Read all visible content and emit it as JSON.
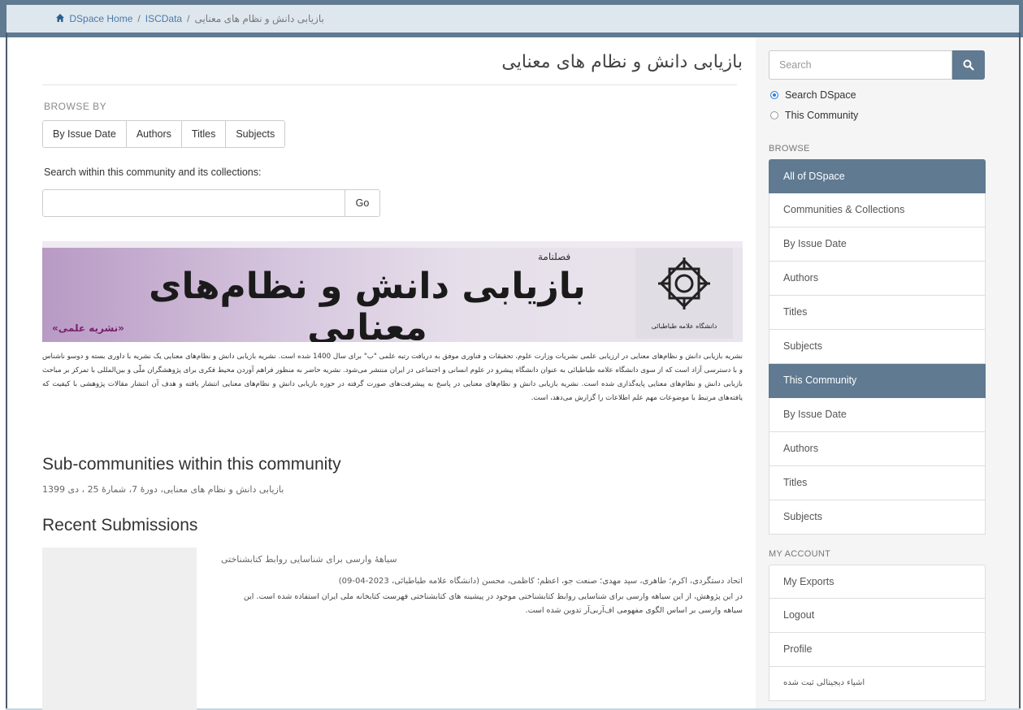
{
  "breadcrumb": {
    "home": "DSpace Home",
    "sep": "/",
    "parent": "ISCData",
    "current": "بازیابی دانش و نظام های معنایی"
  },
  "main": {
    "title": "بازیابی دانش و نظام های معنایی",
    "browse_by_label": "BROWSE BY",
    "browse_buttons": [
      "By Issue Date",
      "Authors",
      "Titles",
      "Subjects"
    ],
    "search_within_label": "Search within this community and its collections:",
    "search_value": "",
    "go_label": "Go",
    "banner": {
      "subtitle": "فصلنامة",
      "title": "بازیابی دانش و نظام‌های معنایی",
      "badge": "«نشریه علمی»",
      "logo_text": "دانشگاه علامه طباطبائی"
    },
    "description": "نشریه بازیابی دانش و نظام‌های معنایی در ارزیابی علمی نشریات وزارت علوم، تحقیقات و فناوری موفق به دریافت رتبه علمی \"ب\" برای سال 1400 شده است. نشریه بازیابی دانش و نظام‌های معنایی یک نشریه با داوری بسته و دوسو ناشناس و با دسترسی آزاد است که از سوی دانشگاه علامه طباطبائی به عنوان دانشگاه پیشرو در علوم انسانی و اجتماعی در ایران منتشر می‌شود. نشریه حاضر به منظور فراهم آوردن محیط فکری برای پژوهشگران ملّی و بین‌المللی با تمرکز بر مباحث بازیابی دانش و نظام‌های معنایی پایه‌گذاری شده است. نشریه بازیابی دانش و نظام‌های معنایی در پاسخ به پیشرفت‌های صورت گرفته در حوزه بازیابی دانش و نظام‌های معنایی انتشار یافته و هدف آن انتشار مقالات پژوهشی با کیفیت که یافته‌های مرتبط با موضوعات مهم علم اطلاعات را گزارش می‌دهد، است.",
    "sub_communities_heading": "Sub-communities within this community",
    "sub_community_item": "بازیابی دانش و نظام های معنایی، دورهٔ 7، شمارهٔ 25 ، دی 1399",
    "recent_heading": "Recent Submissions",
    "recent_items": [
      {
        "title": "سیاههٔ وارسی برای شناسایی روابط کتابشناختی",
        "authors": "اتحاد دستگردی، اکرم؛ طاهری، سید مهدی؛ صنعت جو، اعظم؛ کاظمی، محسن (دانشگاه علامه طباطبائی، 2023-04-09)",
        "abstract": "در این پژوهش، از این سیاهه وارسی برای شناسایی روابط کتابشناختی موجود در پیشینه های کتابشناختی فهرست کتابخانه ملی ایران استفاده شده است. این سیاهه وارسی بر اساس الگوی مفهومی اف‌آر‌بی‌آر تدوین شده است."
      }
    ]
  },
  "sidebar": {
    "search_placeholder": "Search",
    "radio_search_dspace": "Search DSpace",
    "radio_this_community": "This Community",
    "browse_label": "BROWSE",
    "browse_items": [
      "All of DSpace",
      "Communities & Collections",
      "By Issue Date",
      "Authors",
      "Titles",
      "Subjects",
      "This Community",
      "By Issue Date",
      "Authors",
      "Titles",
      "Subjects"
    ],
    "my_account_label": "MY ACCOUNT",
    "account_items": [
      "My Exports",
      "Logout",
      "Profile",
      "اشیاء دیجیتالی ثبت شده"
    ]
  },
  "colors": {
    "nav_bar": "#5f7a91",
    "breadcrumb_bg": "#dfe7ee",
    "active_item": "#5f7a91"
  }
}
